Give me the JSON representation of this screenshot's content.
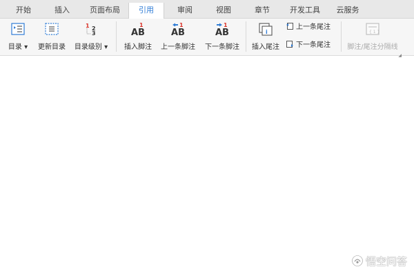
{
  "tabs": [
    {
      "label": "开始"
    },
    {
      "label": "插入"
    },
    {
      "label": "页面布局"
    },
    {
      "label": "引用",
      "active": true
    },
    {
      "label": "审阅"
    },
    {
      "label": "视图"
    },
    {
      "label": "章节"
    },
    {
      "label": "开发工具"
    },
    {
      "label": "云服务"
    }
  ],
  "ribbon": {
    "toc": {
      "label": "目录 ▾",
      "icon": "toc-icon"
    },
    "update_toc": {
      "label": "更新目录",
      "icon": "update-toc-icon"
    },
    "toc_level": {
      "label": "目录级别 ▾",
      "icon": "toc-level-icon"
    },
    "insert_footnote": {
      "label": "插入脚注",
      "icon": "insert-footnote-icon"
    },
    "prev_footnote": {
      "label": "上一条脚注",
      "icon": "prev-footnote-icon"
    },
    "next_footnote": {
      "label": "下一条脚注",
      "icon": "next-footnote-icon"
    },
    "insert_endnote": {
      "label": "插入尾注",
      "icon": "insert-endnote-icon"
    },
    "prev_endnote": {
      "label": "上一条尾注",
      "icon": "prev-endnote-icon"
    },
    "next_endnote": {
      "label": "下一条尾注",
      "icon": "next-endnote-icon"
    },
    "separator": {
      "label": "脚注/尾注分隔线",
      "icon": "separator-line-icon",
      "disabled": true
    }
  },
  "watermark": {
    "text": "悟空问答",
    "icon": "wukong-logo-icon"
  },
  "colors": {
    "accent": "#2f7cd6",
    "footnote_red": "#d9342b",
    "arrow_blue": "#2f7cd6"
  }
}
